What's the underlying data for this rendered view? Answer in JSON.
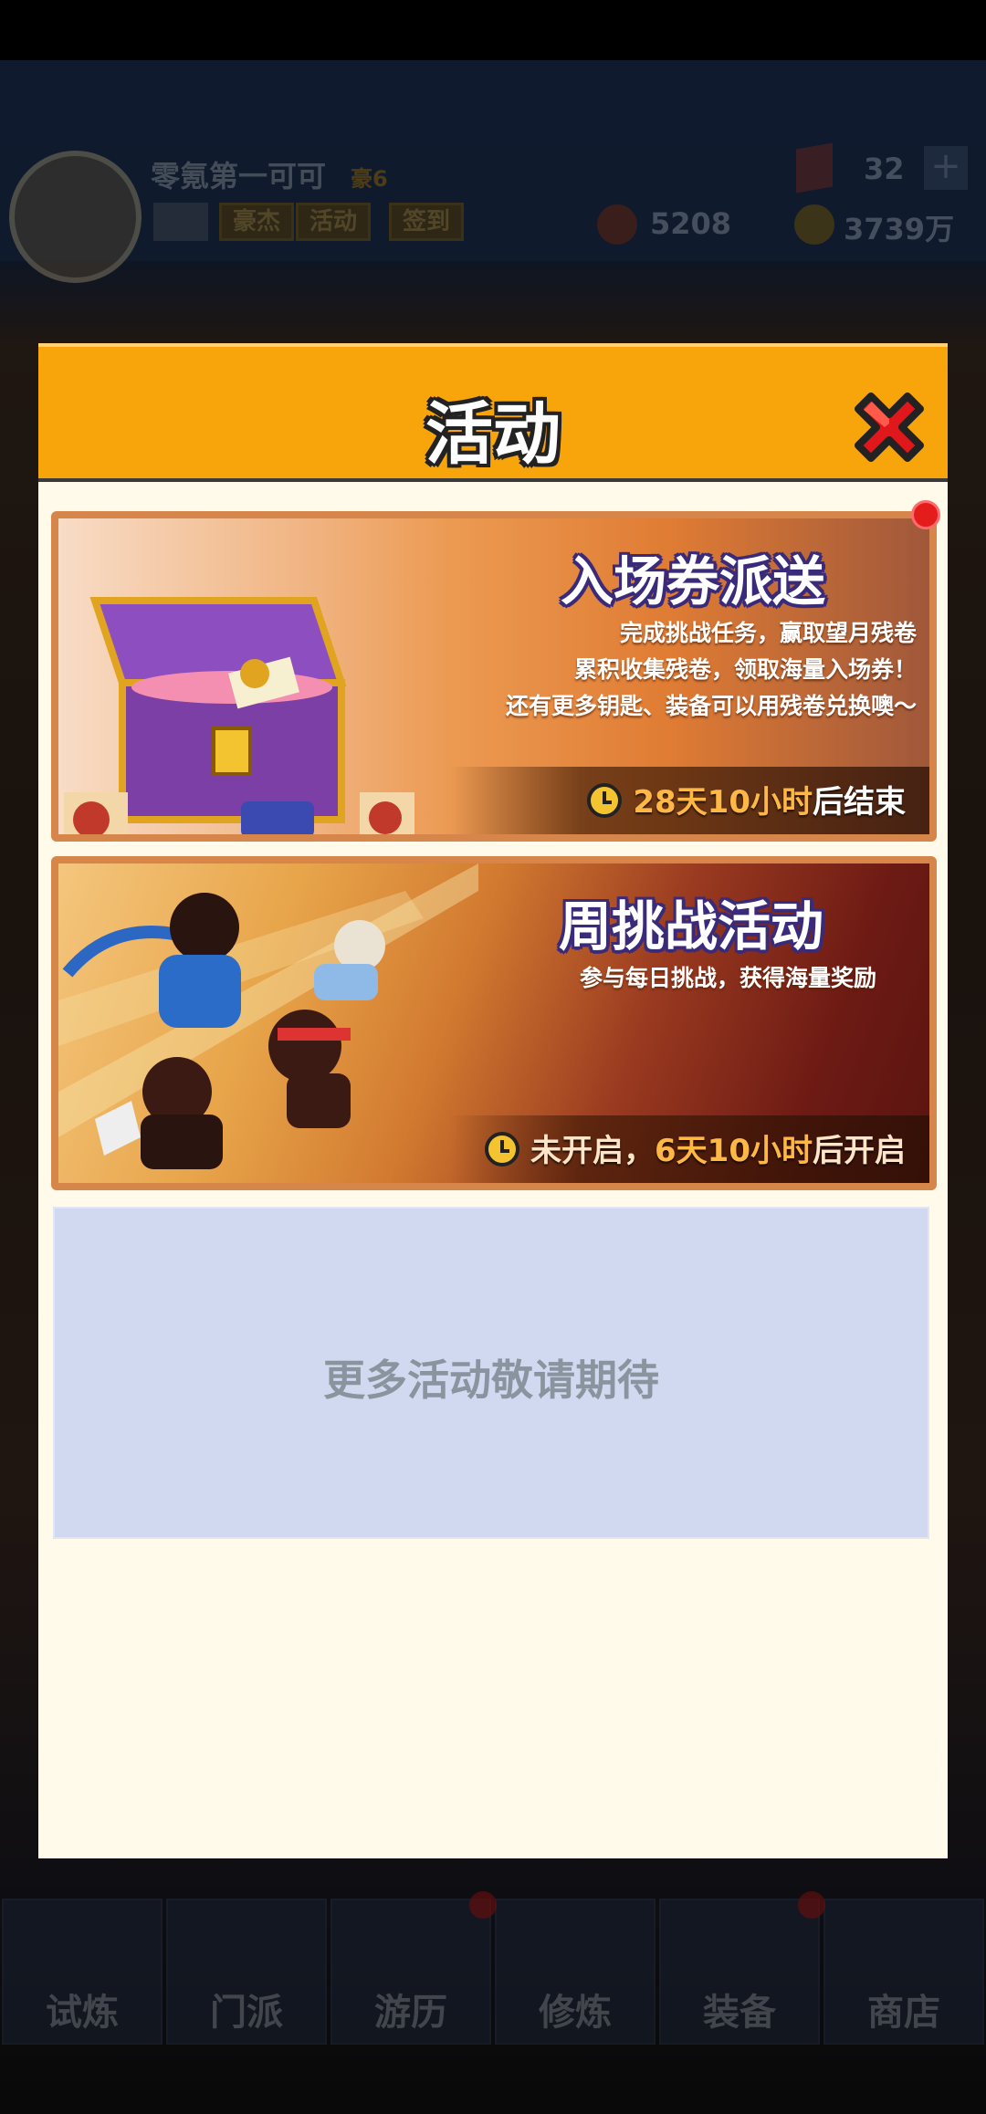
{
  "header": {
    "player_name": "零氪第一可可",
    "vip": "豪6",
    "pills": [
      "豪杰",
      "活动",
      "签到"
    ],
    "gems": "32",
    "medals": "5208",
    "gold": "3739万"
  },
  "modal": {
    "title": "活动",
    "banners": [
      {
        "title": "入场券派送",
        "desc": [
          "完成挑战任务，赢取望月残卷",
          "累积收集残卷，领取海量入场券！",
          "还有更多钥匙、装备可以用残卷兑换噢～"
        ],
        "timer_highlight": "28天10小时",
        "timer_suffix": "后结束",
        "has_notification": true
      },
      {
        "title": "周挑战活动",
        "desc": [
          "参与每日挑战，获得海量奖励"
        ],
        "timer_prefix": "未开启，",
        "timer_highlight": "6天10小时",
        "timer_suffix": "后开启",
        "has_notification": false
      }
    ],
    "placeholder": "更多活动敬请期待"
  },
  "nav": {
    "items": [
      "试炼",
      "门派",
      "游历",
      "修炼",
      "装备",
      "商店"
    ]
  },
  "colors": {
    "modal_header": "#f8a50b",
    "modal_bg": "#fffaea",
    "placeholder_bg": "#d1d9f1",
    "timer_highlight": "#ffb845",
    "notification": "#e51c1c"
  }
}
